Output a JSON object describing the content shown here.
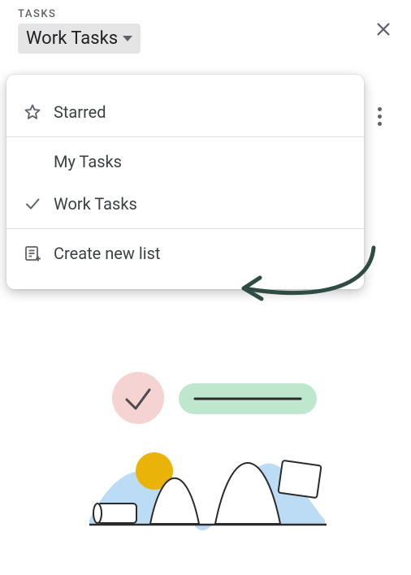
{
  "header": {
    "title_label": "TASKS",
    "selected_list": "Work Tasks"
  },
  "dropdown": {
    "starred_label": "Starred",
    "lists": [
      {
        "label": "My Tasks",
        "selected": false
      },
      {
        "label": "Work Tasks",
        "selected": true
      }
    ],
    "create_label": "Create new list"
  }
}
